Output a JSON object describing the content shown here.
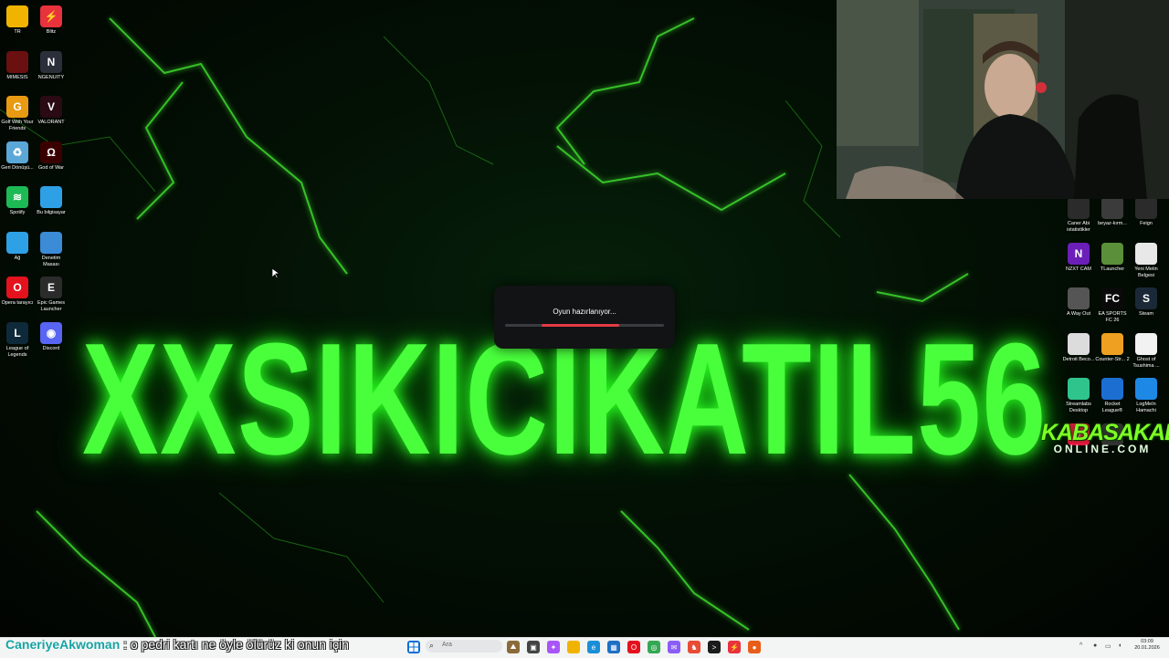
{
  "wallpaper": {
    "title": "XXSIKICIKATIL56"
  },
  "left_icons": [
    {
      "label": "TR",
      "color": "#f0b400",
      "name": "folder-icon",
      "glyph": ""
    },
    {
      "label": "Blitz",
      "color": "#e8323c",
      "name": "blitz-icon",
      "glyph": "⚡"
    },
    {
      "label": "MIMESIS",
      "color": "#6a1010",
      "name": "mimesis-icon",
      "glyph": ""
    },
    {
      "label": "NGENUITY",
      "color": "#2a2f3a",
      "name": "ngenuity-icon",
      "glyph": "N"
    },
    {
      "label": "Golf With Your Friends",
      "color": "#e79a12",
      "name": "golf-icon",
      "glyph": "G"
    },
    {
      "label": "VALORANT",
      "color": "#2a0a14",
      "name": "valorant-icon",
      "glyph": "V"
    },
    {
      "label": "Geri Dönüşü...",
      "color": "#5aa7d8",
      "name": "recycle-bin-icon",
      "glyph": "♻"
    },
    {
      "label": "God of War",
      "color": "#3a0000",
      "name": "god-of-war-icon",
      "glyph": "Ω"
    },
    {
      "label": "Spotify",
      "color": "#1db954",
      "name": "spotify-icon",
      "glyph": "≋"
    },
    {
      "label": "Bu bilgisayar",
      "color": "#2ea1e6",
      "name": "this-pc-icon",
      "glyph": ""
    },
    {
      "label": "Ağ",
      "color": "#2ea1e6",
      "name": "network-icon",
      "glyph": ""
    },
    {
      "label": "Denetim Masası",
      "color": "#3b8bd6",
      "name": "control-panel-icon",
      "glyph": ""
    },
    {
      "label": "Opera tarayıcı",
      "color": "#e4121d",
      "name": "opera-icon",
      "glyph": "O"
    },
    {
      "label": "Epic Games Launcher",
      "color": "#2b2b2b",
      "name": "epic-games-icon",
      "glyph": "E"
    },
    {
      "label": "League of Legends",
      "color": "#0e2a3a",
      "name": "league-icon",
      "glyph": "L"
    },
    {
      "label": "Discord",
      "color": "#5865f2",
      "name": "discord-icon",
      "glyph": "◉"
    }
  ],
  "right_icons": [
    {
      "label": "Caner Abi istatistikler",
      "color": "#2b2b2b",
      "name": "stats-icon",
      "glyph": ""
    },
    {
      "label": "beyaz-kırm...",
      "color": "#3b3b3b",
      "name": "image-file-icon",
      "glyph": ""
    },
    {
      "label": "Feign",
      "color": "#2b2b2b",
      "name": "feign-icon",
      "glyph": ""
    },
    {
      "label": "NZXT CAM",
      "color": "#6b1fb8",
      "name": "nzxt-icon",
      "glyph": "N"
    },
    {
      "label": "TLauncher",
      "color": "#5b8f3a",
      "name": "tlauncher-icon",
      "glyph": ""
    },
    {
      "label": "Yeni Metin Belgesi",
      "color": "#e8e8e8",
      "name": "text-file-icon",
      "glyph": ""
    },
    {
      "label": "A Way Out",
      "color": "#555555",
      "name": "a-way-out-icon",
      "glyph": ""
    },
    {
      "label": "EA SPORTS FC 26",
      "color": "#0a0a0a",
      "name": "fc26-icon",
      "glyph": "FC"
    },
    {
      "label": "Steam",
      "color": "#1b2838",
      "name": "steam-icon",
      "glyph": "S"
    },
    {
      "label": "Detroit Beco...",
      "color": "#dcdcdc",
      "name": "detroit-icon",
      "glyph": ""
    },
    {
      "label": "Counter-Str... 2",
      "color": "#f0a020",
      "name": "cs2-icon",
      "glyph": ""
    },
    {
      "label": "Ghost of Tsushima ...",
      "color": "#f2f2f2",
      "name": "ghost-of-tsushima-icon",
      "glyph": ""
    },
    {
      "label": "Streamlabs Desktop",
      "color": "#30c48d",
      "name": "streamlabs-icon",
      "glyph": ""
    },
    {
      "label": "Rocket League®",
      "color": "#1c6fd1",
      "name": "rocket-league-icon",
      "glyph": ""
    },
    {
      "label": "LogMeIn Hamachi",
      "color": "#1e88e5",
      "name": "hamachi-icon",
      "glyph": ""
    },
    {
      "label": "",
      "color": "#e6163d",
      "name": "tiktok-icon",
      "glyph": "♪"
    },
    {
      "label": "",
      "color": "#333333",
      "name": "shortcut-icon",
      "glyph": ""
    }
  ],
  "overlay": {
    "brand_line1": "KABASAKAL",
    "brand_line2": "ONLINE.COM"
  },
  "dialog": {
    "message": "Oyun hazırlanıyor...",
    "progress": 0.72
  },
  "chat": {
    "user": "CaneriyeAkwoman",
    "message": ": o pedri kartı ne öyle ölürüz ki onun için"
  },
  "taskbar": {
    "search_placeholder": "Ara",
    "time": "03:09",
    "date": "20.01.2026",
    "apps": [
      {
        "name": "widgets-icon",
        "color": "#8a6a3a",
        "glyph": "⛰"
      },
      {
        "name": "task-view-icon",
        "color": "#444",
        "glyph": "▣"
      },
      {
        "name": "copilot-icon",
        "color": "#a855f7",
        "glyph": "✦"
      },
      {
        "name": "file-explorer-icon",
        "color": "#f0b400",
        "glyph": ""
      },
      {
        "name": "edge-icon",
        "color": "#1a8fd8",
        "glyph": "e"
      },
      {
        "name": "store-icon",
        "color": "#1f6fc5",
        "glyph": "▦"
      },
      {
        "name": "opera-taskbar-icon",
        "color": "#e4121d",
        "glyph": "O"
      },
      {
        "name": "chrome-icon",
        "color": "#34a853",
        "glyph": "◎"
      },
      {
        "name": "messenger-icon",
        "color": "#8b5cf6",
        "glyph": "✉"
      },
      {
        "name": "chess-icon",
        "color": "#e94b35",
        "glyph": "♞"
      },
      {
        "name": "terminal-icon",
        "color": "#1b1b1b",
        "glyph": ">"
      },
      {
        "name": "game-client-icon",
        "color": "#e8323c",
        "glyph": "⚡"
      },
      {
        "name": "record-icon",
        "color": "#e85d1a",
        "glyph": "●"
      }
    ]
  }
}
